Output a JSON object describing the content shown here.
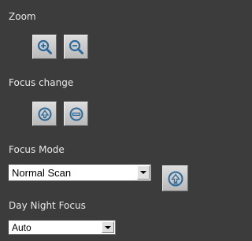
{
  "zoom": {
    "label": "Zoom",
    "zoom_in_icon": "zoom-in-magnifier-plus",
    "zoom_out_icon": "zoom-out-magnifier-minus"
  },
  "focus_change": {
    "label": "Focus change",
    "focus_near_icon": "focus-plus-circle",
    "focus_far_icon": "focus-minus-circle"
  },
  "focus_mode": {
    "label": "Focus Mode",
    "selected": "Normal Scan",
    "auto_focus_icon": "one-push-focus-icon"
  },
  "day_night_focus": {
    "label": "Day Night Focus",
    "selected": "Auto"
  },
  "colors": {
    "background": "#3c3c3c",
    "label_text": "#e9e9e9",
    "icon_blue": "#2d6a9a"
  }
}
